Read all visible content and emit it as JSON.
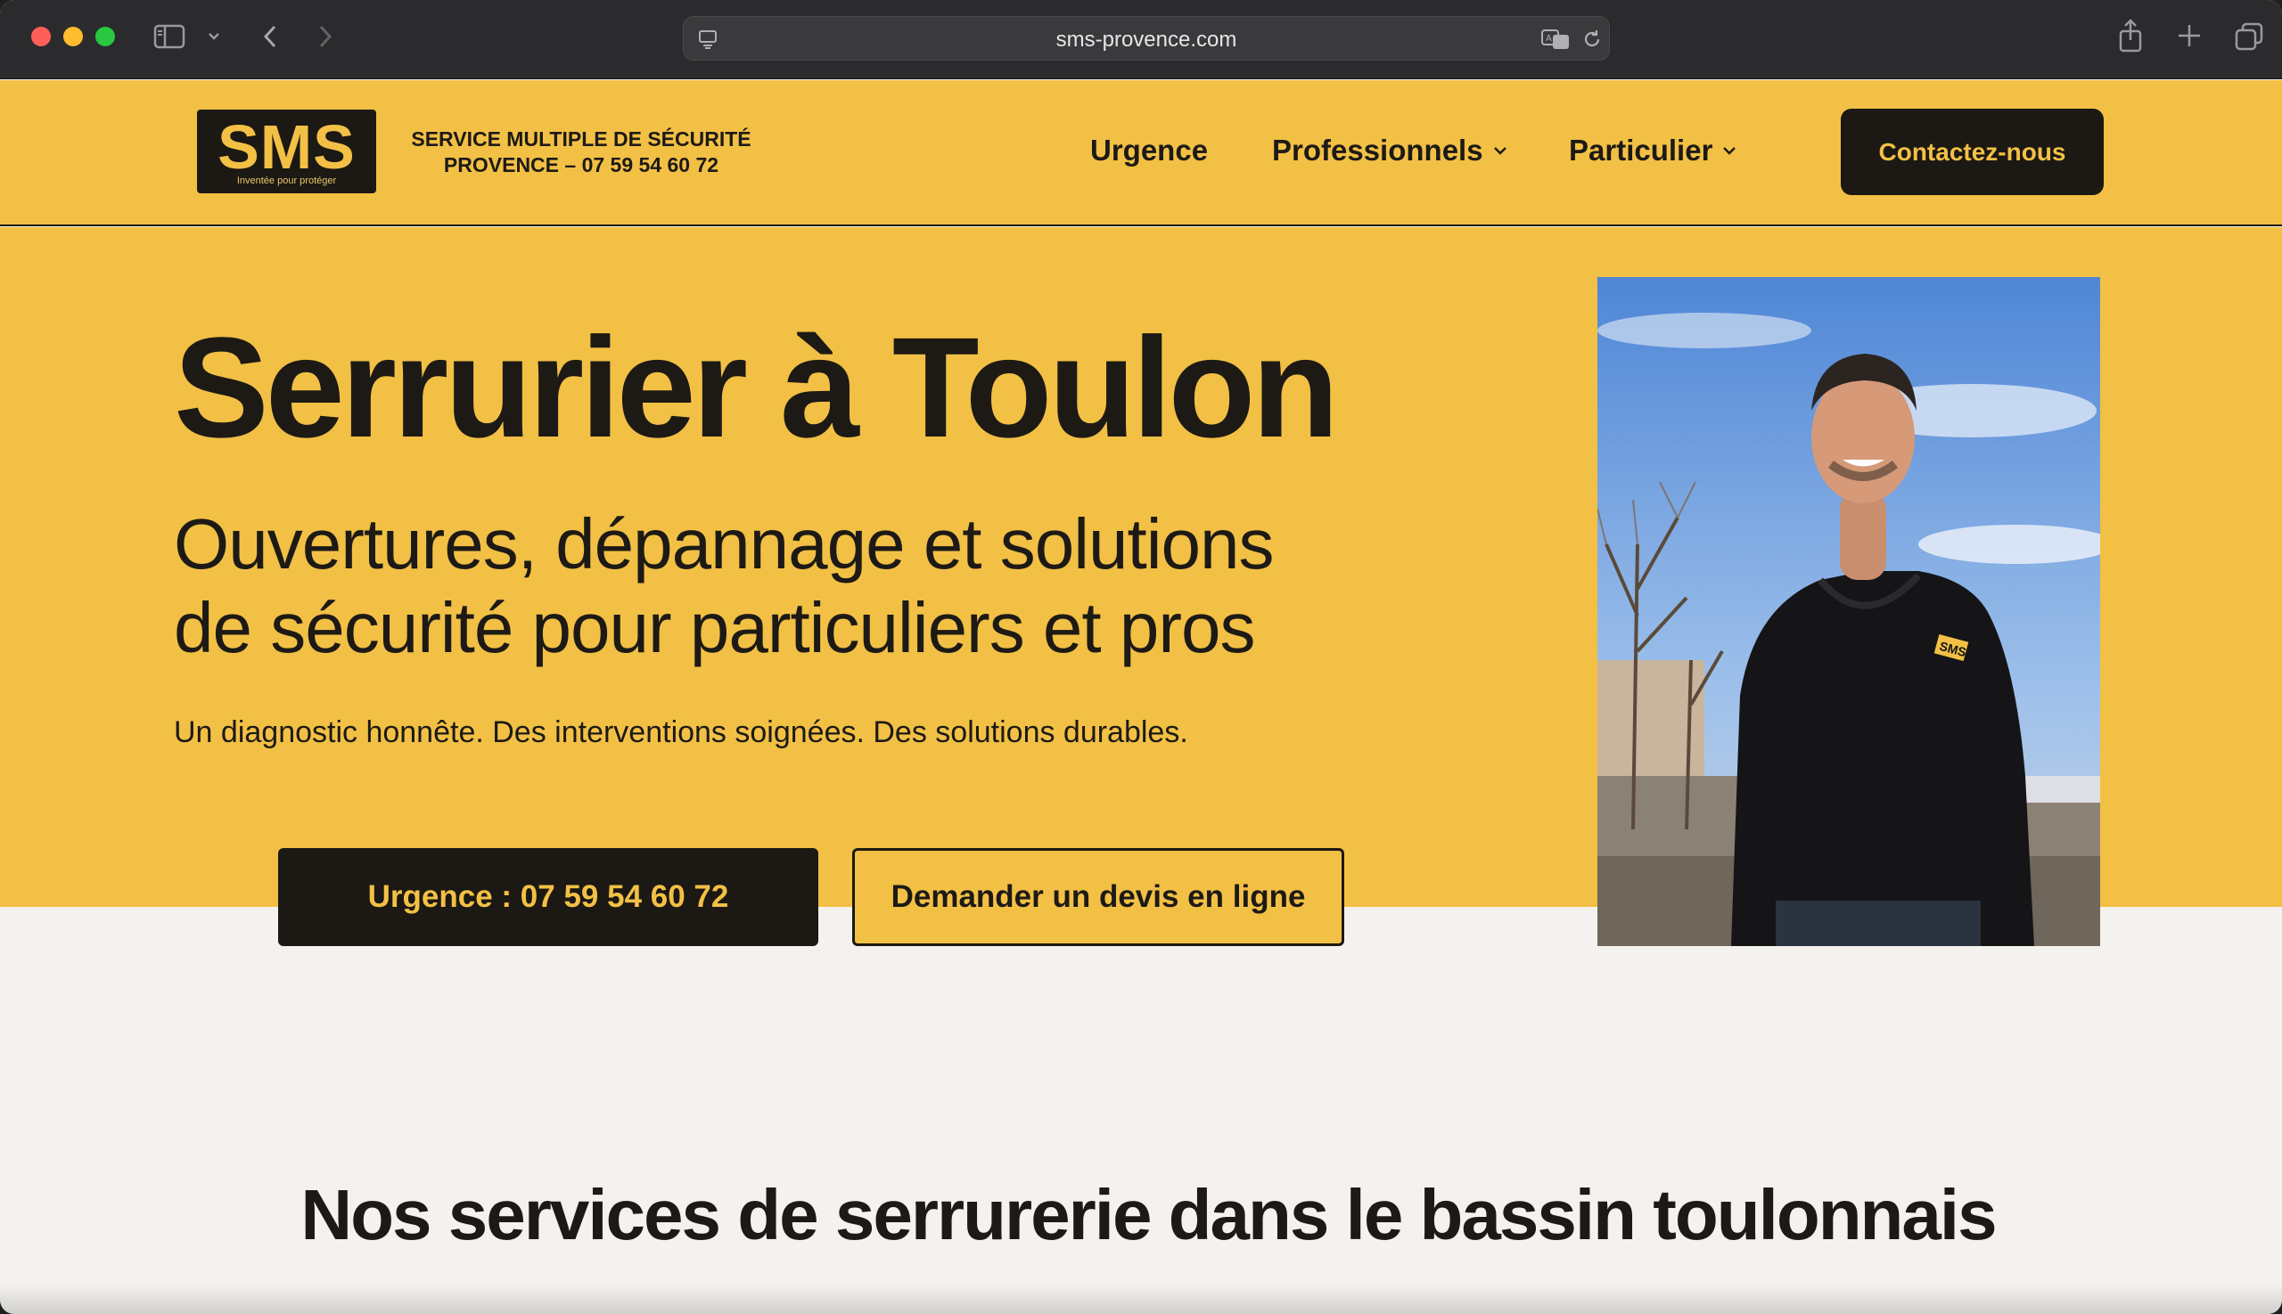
{
  "browser": {
    "url": "sms-provence.com",
    "icons": {
      "sidebar": "sidebar-icon",
      "sidebar_menu": "chevron-down-icon",
      "back": "back-icon",
      "forward": "forward-icon",
      "reader": "reader-icon",
      "translate": "translate-icon",
      "reload": "reload-icon",
      "share": "share-icon",
      "new_tab": "plus-icon",
      "tabs_overview": "tabs-icon"
    }
  },
  "header": {
    "logo_text": "SMS",
    "logo_tagline": "Inventée pour protéger",
    "brand_line1": "SERVICE MULTIPLE DE SÉCURITÉ",
    "brand_line2": "PROVENCE – 07 59 54 60 72",
    "nav": {
      "urgence": "Urgence",
      "professionnels": "Professionnels",
      "particulier": "Particulier"
    },
    "contact_label": "Contactez-nous"
  },
  "hero": {
    "title": "Serrurier à Toulon",
    "subtitle_line1": "Ouvertures, dépannage et solutions",
    "subtitle_line2": "de sécurité pour particuliers et pros",
    "tagline": "Un diagnostic honnête. Des interventions soignées. Des solutions durables.",
    "btn_urgence": "Urgence : 07 59 54 60 72",
    "btn_devis": "Demander un devis en ligne",
    "photo_badge": "SMS"
  },
  "services": {
    "title": "Nos services de serrurerie dans le bassin toulonnais"
  },
  "colors": {
    "brand_yellow": "#f2c045",
    "brand_dark": "#1c1813",
    "background": "#f4f2ee"
  }
}
